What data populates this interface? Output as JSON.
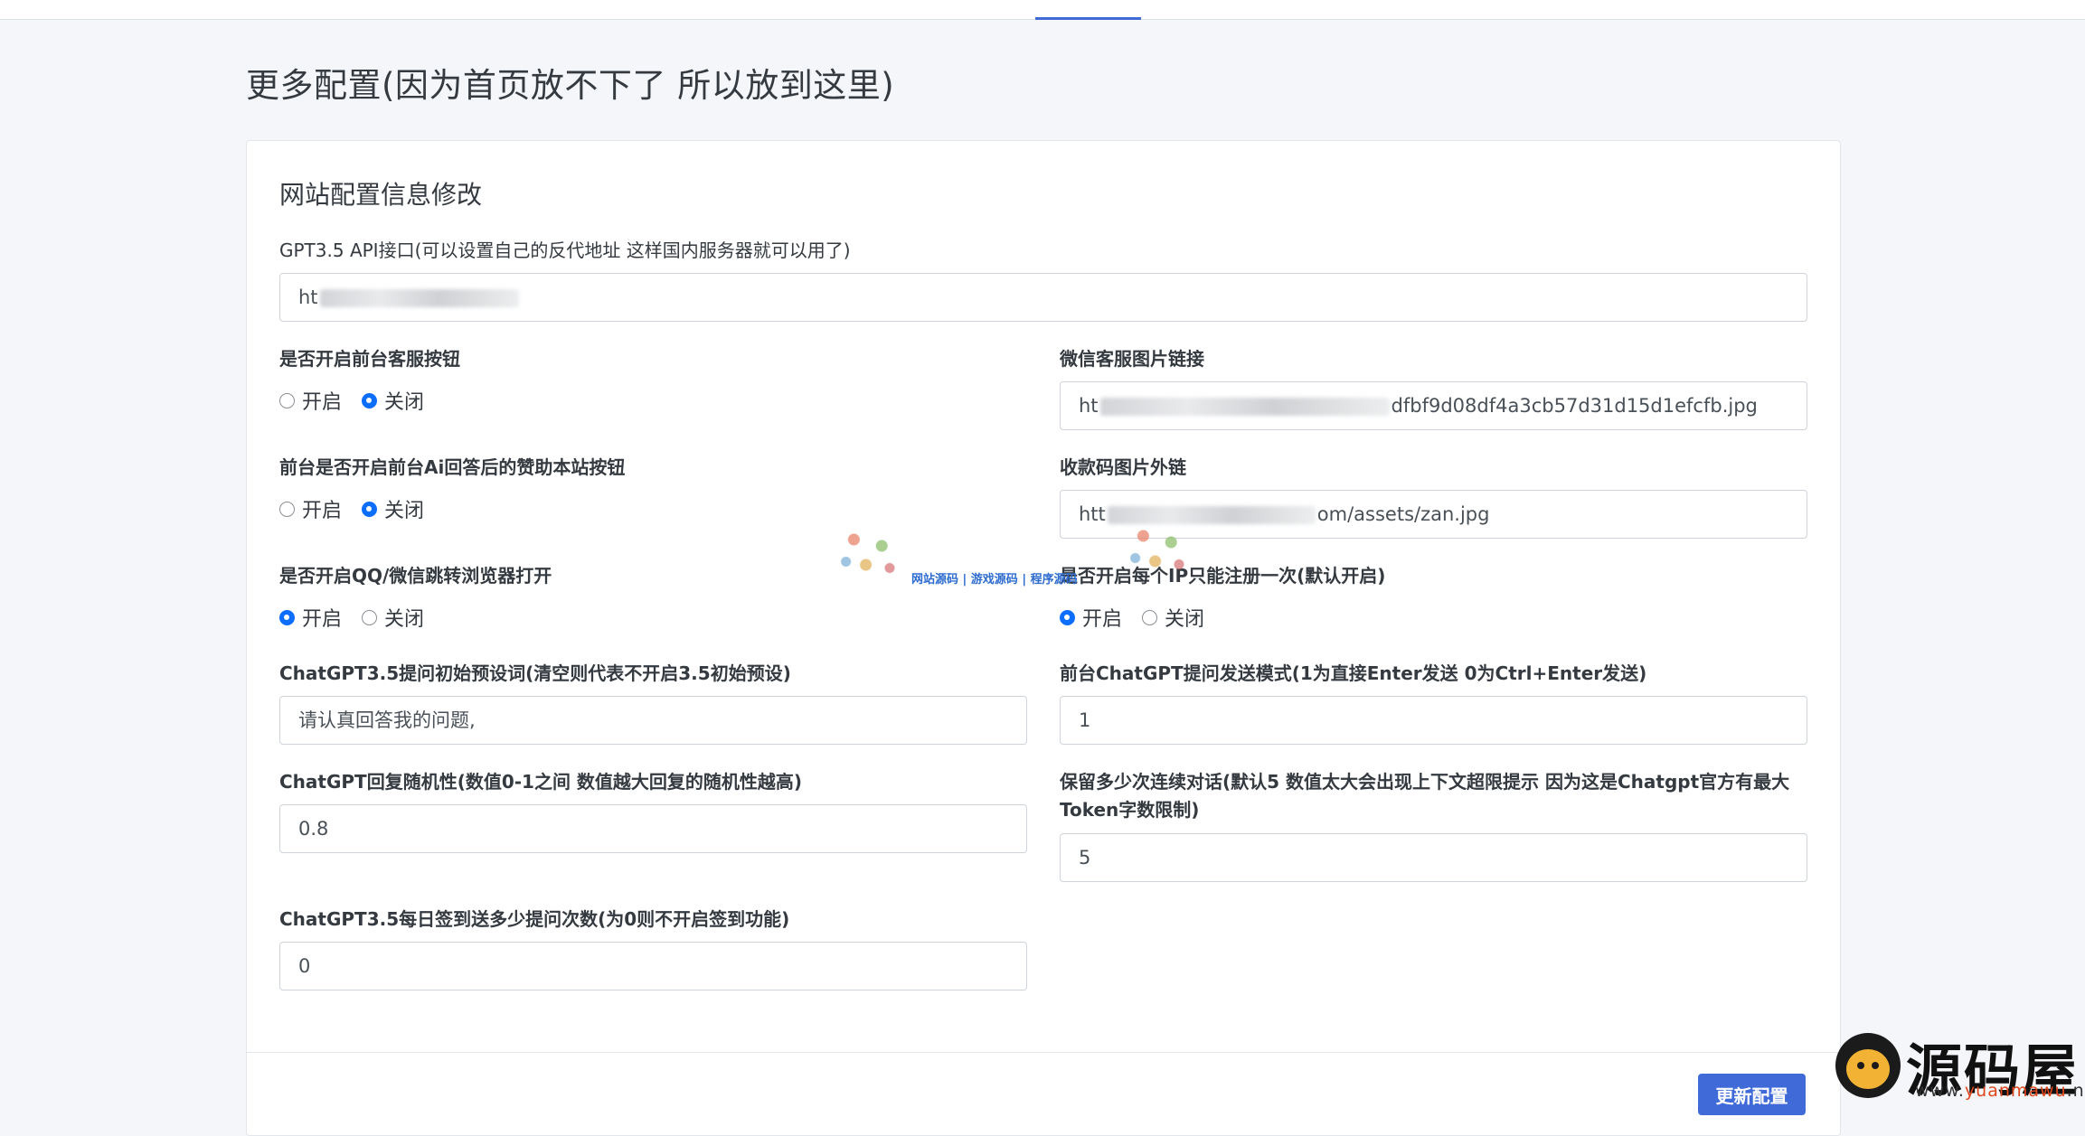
{
  "page_title": "更多配置(因为首页放不下了 所以放到这里)",
  "card_title": "网站配置信息修改",
  "fields": {
    "api": {
      "label": "GPT3.5 API接口(可以设置自己的反代地址 这样国内服务器就可以用了)",
      "value_prefix": "ht"
    },
    "kefu_button": {
      "label": "是否开启前台客服按钮",
      "option_on": "开启",
      "option_off": "关闭",
      "selected": "关闭"
    },
    "wechat_image": {
      "label": "微信客服图片链接",
      "value_prefix": "ht",
      "value_suffix": "dfbf9d08df4a3cb57d31d15d1efcfb.jpg"
    },
    "sponsor_button": {
      "label": "前台是否开启前台Ai回答后的赞助本站按钮",
      "option_on": "开启",
      "option_off": "关闭",
      "selected": "关闭"
    },
    "payment_image": {
      "label": "收款码图片外链",
      "value_prefix": "htt",
      "value_suffix": "om/assets/zan.jpg"
    },
    "qq_browser": {
      "label": "是否开启QQ/微信跳转浏览器打开",
      "option_on": "开启",
      "option_off": "关闭",
      "selected": "开启"
    },
    "ip_register": {
      "label": "是否开启每个IP只能注册一次(默认开启)",
      "option_on": "开启",
      "option_off": "关闭",
      "selected": "开启"
    },
    "preset_prompt": {
      "label": "ChatGPT3.5提问初始预设词(清空则代表不开启3.5初始预设)",
      "value": "请认真回答我的问题,"
    },
    "send_mode": {
      "label": "前台ChatGPT提问发送模式(1为直接Enter发送 0为Ctrl+Enter发送)",
      "value": "1"
    },
    "randomness": {
      "label": "ChatGPT回复随机性(数值0-1之间 数值越大回复的随机性越高)",
      "value": "0.8"
    },
    "context_count": {
      "label_line1": "保留多少次连续对话(默认5 数值太大会出现上下文超限提示 因为这是Chatgpt官方有最大",
      "label_line2": "Token字数限制)",
      "value": "5"
    },
    "signin": {
      "label": "ChatGPT3.5每日签到送多少提问次数(为0则不开启签到功能)",
      "value": "0"
    }
  },
  "submit_label": "更新配置",
  "watermark_text": "网站源码 | 游戏源码 | 程序源码",
  "logo": {
    "cn": "源码屋",
    "url_pre": "www.",
    "url_highlight": "yuanmawu",
    "url_post": ".net"
  },
  "colors": {
    "primary": "#3f6ad8",
    "radio_checked": "#0d6efd",
    "background": "#f4f6f9"
  }
}
